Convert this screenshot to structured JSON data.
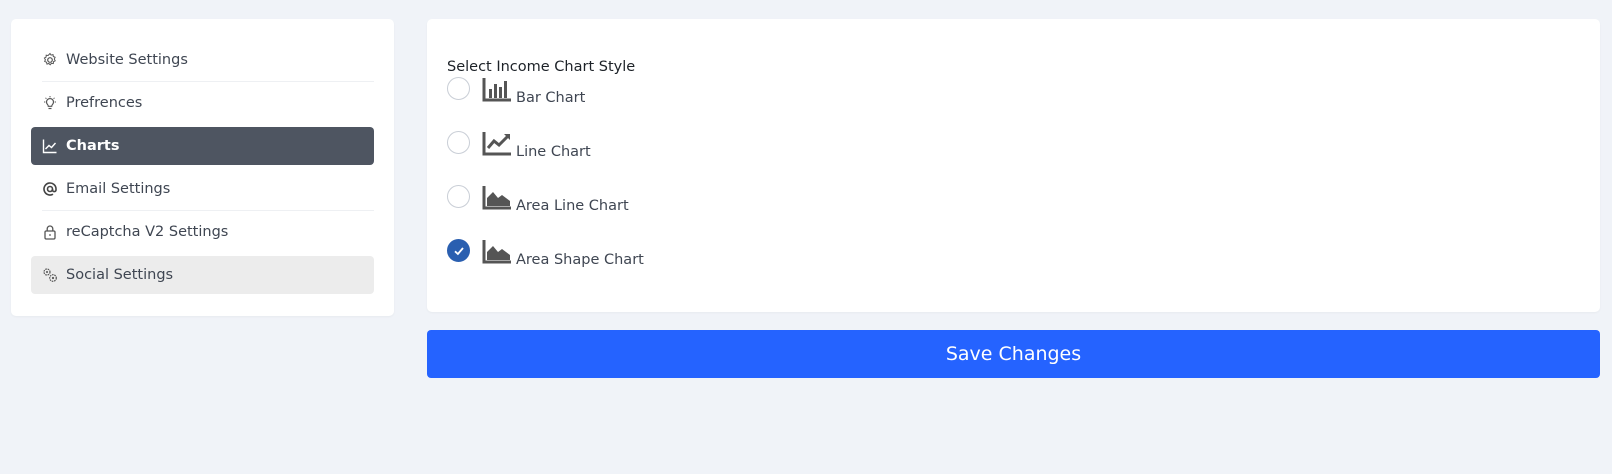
{
  "sidebar": {
    "items": [
      {
        "label": "Website Settings",
        "icon": "gear-icon"
      },
      {
        "label": "Prefrences",
        "icon": "lightbulb-icon"
      },
      {
        "label": "Charts",
        "icon": "line-chart-icon",
        "active": true
      },
      {
        "label": "Email Settings",
        "icon": "at-sign-icon"
      },
      {
        "label": "reCaptcha V2 Settings",
        "icon": "lock-icon"
      },
      {
        "label": "Social Settings",
        "icon": "gears-icon",
        "hovered": true
      }
    ]
  },
  "panel": {
    "title": "Select Income Chart Style",
    "options": [
      {
        "label": "Bar Chart",
        "icon": "bar-chart-icon",
        "checked": false
      },
      {
        "label": "Line Chart",
        "icon": "line-chart-icon",
        "checked": false
      },
      {
        "label": "Area Line Chart",
        "icon": "area-chart-icon",
        "checked": false
      },
      {
        "label": "Area Shape Chart",
        "icon": "area-chart-icon",
        "checked": true
      }
    ]
  },
  "actions": {
    "save_label": "Save Changes"
  },
  "colors": {
    "active_item_bg": "#4e5561",
    "save_button_bg": "#2563ff",
    "radio_checked": "#2a5fb0",
    "page_bg": "#f0f3f8"
  }
}
